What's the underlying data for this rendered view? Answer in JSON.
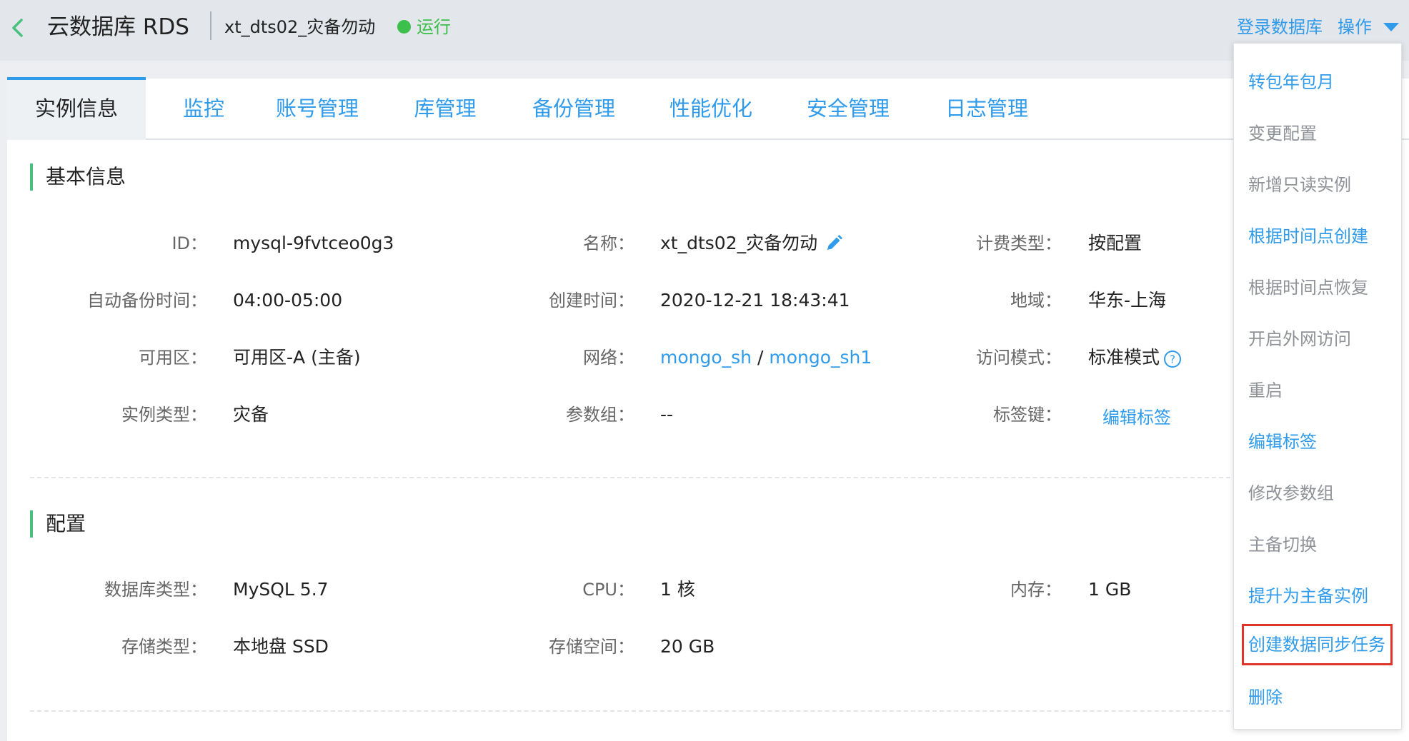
{
  "header": {
    "back_icon": "chevron-left-icon",
    "app_title": "云数据库 RDS",
    "instance_name": "xt_dts02_灾备勿动",
    "status_text": "运行",
    "status_color": "#3dbf4b",
    "login_link": "登录数据库",
    "operations_link": "操作",
    "accent_color": "#2f9bea"
  },
  "tabs": [
    {
      "label": "实例信息",
      "active": true
    },
    {
      "label": "监控"
    },
    {
      "label": "账号管理"
    },
    {
      "label": "库管理"
    },
    {
      "label": "备份管理"
    },
    {
      "label": "性能优化"
    },
    {
      "label": "安全管理"
    },
    {
      "label": "日志管理"
    }
  ],
  "basic": {
    "title": "基本信息",
    "id_label": "ID：",
    "id_value": "mysql-9fvtceo0g3",
    "name_label": "名称：",
    "name_value": "xt_dts02_灾备勿动",
    "billing_label": "计费类型：",
    "billing_value": "按配置",
    "backup_time_label": "自动备份时间：",
    "backup_time_value": "04:00-05:00",
    "created_label": "创建时间：",
    "created_value": "2020-12-21 18:43:41",
    "region_label": "地域：",
    "region_value": "华东-上海",
    "zone_label": "可用区：",
    "zone_value": "可用区-A (主备)",
    "network_label": "网络：",
    "network_vpc": "mongo_sh",
    "network_sep": "/",
    "network_subnet": "mongo_sh1",
    "access_label": "访问模式：",
    "access_value": "标准模式",
    "instance_type_label": "实例类型：",
    "instance_type_value": "灾备",
    "param_group_label": "参数组：",
    "param_group_value": "--",
    "tag_key_label": "标签键：",
    "tag_key_value": "编辑标签"
  },
  "config": {
    "title": "配置",
    "db_type_label": "数据库类型：",
    "db_type_value": "MySQL 5.7",
    "cpu_label": "CPU：",
    "cpu_value": "1 核",
    "memory_label": "内存：",
    "memory_value": "1 GB",
    "storage_type_label": "存储类型：",
    "storage_type_value": "本地盘 SSD",
    "storage_space_label": "存储空间：",
    "storage_space_value": "20 GB"
  },
  "dropdown_menu": [
    {
      "label": "转包年包月",
      "enabled": true
    },
    {
      "label": "变更配置",
      "enabled": false
    },
    {
      "label": "新增只读实例",
      "enabled": false
    },
    {
      "label": "根据时间点创建",
      "enabled": true
    },
    {
      "label": "根据时间点恢复",
      "enabled": false
    },
    {
      "label": "开启外网访问",
      "enabled": false
    },
    {
      "label": "重启",
      "enabled": false
    },
    {
      "label": "编辑标签",
      "enabled": true
    },
    {
      "label": "修改参数组",
      "enabled": false
    },
    {
      "label": "主备切换",
      "enabled": false
    },
    {
      "label": "提升为主备实例",
      "enabled": true
    },
    {
      "label": "创建数据同步任务",
      "enabled": true,
      "highlighted": true
    },
    {
      "label": "删除",
      "enabled": true
    }
  ]
}
